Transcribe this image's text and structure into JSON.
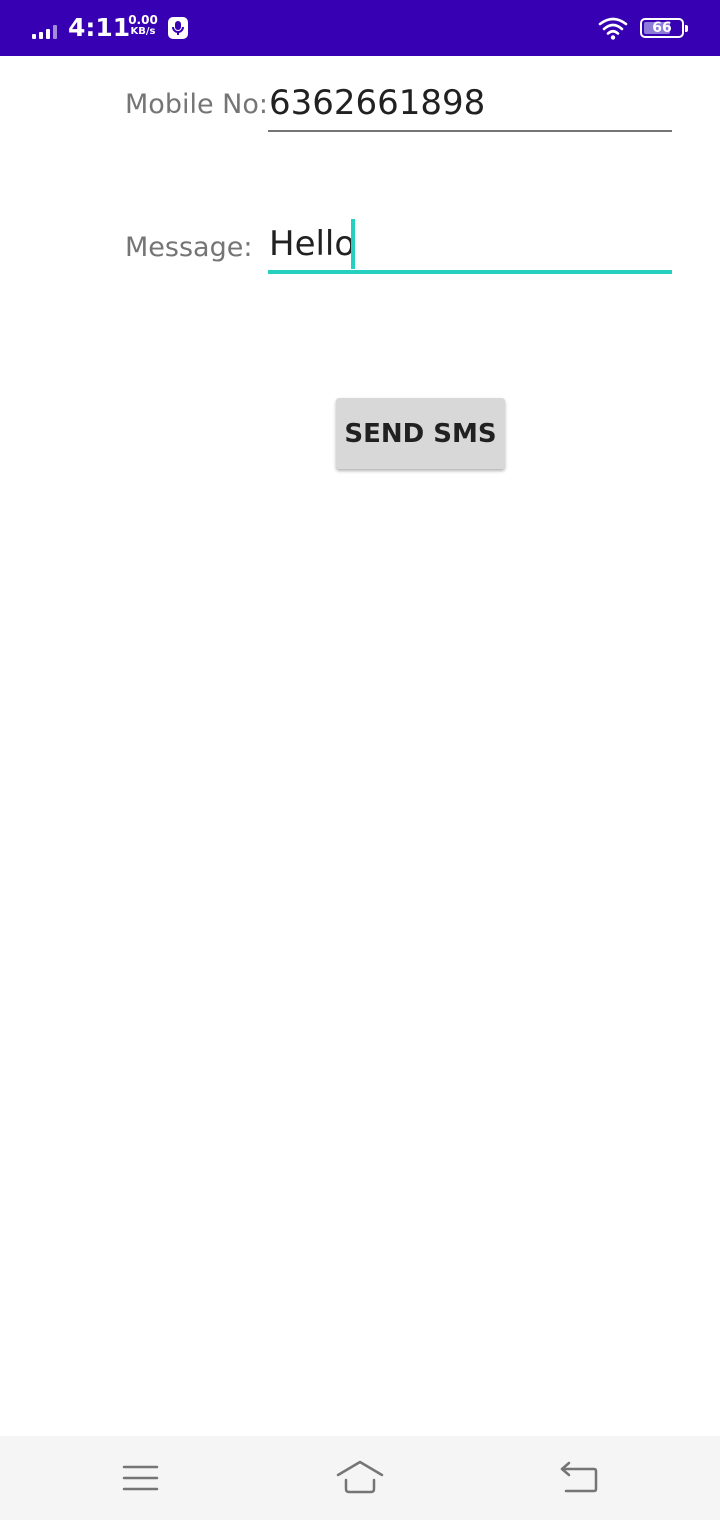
{
  "status_bar": {
    "time": "4:11",
    "net_speed_value": "0.00",
    "net_speed_unit": "KB/s",
    "battery_level": "66",
    "icons": [
      "signal-icon",
      "mic-icon",
      "wifi-icon",
      "battery-icon"
    ],
    "background_color": "#3700b3"
  },
  "form": {
    "mobile_label": "Mobile No:",
    "mobile_value": "6362661898",
    "message_label": "Message:",
    "message_value": "Hello",
    "accent_color": "#26d0bf"
  },
  "actions": {
    "send_label": "SEND SMS"
  },
  "nav_bar": {
    "icons": [
      "menu-icon",
      "home-icon",
      "back-icon"
    ]
  }
}
